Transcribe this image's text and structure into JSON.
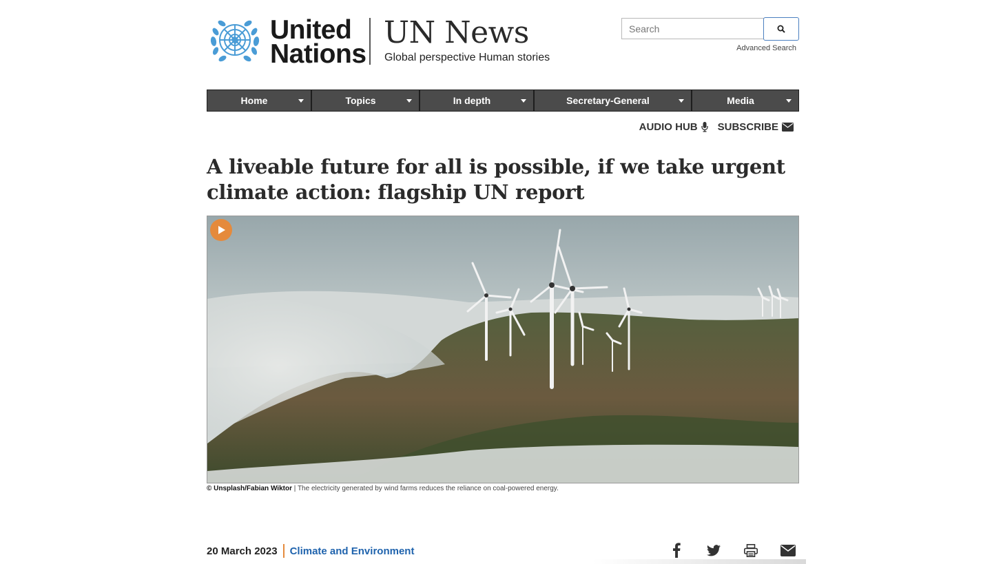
{
  "header": {
    "org_name_line1": "United",
    "org_name_line2": "Nations",
    "site_title": "UN News",
    "tagline": "Global perspective Human stories",
    "search_placeholder": "Search",
    "advanced_search": "Advanced Search",
    "logo_icon": "un-emblem-icon",
    "brand_blue": "#4a9cd6"
  },
  "nav": {
    "items": [
      {
        "label": "Home"
      },
      {
        "label": "Topics"
      },
      {
        "label": "In depth"
      },
      {
        "label": "Secretary-General"
      },
      {
        "label": "Media"
      }
    ],
    "background": "#4b4b4b"
  },
  "utility": {
    "audio_hub": "AUDIO HUB",
    "audio_icon": "microphone-icon",
    "subscribe": "SUBSCRIBE",
    "subscribe_icon": "envelope-icon"
  },
  "article": {
    "headline": "A liveable future for all is possible, if we take urgent climate action: flagship UN report",
    "image_credit": "© Unsplash/Fabian Wiktor",
    "image_caption": " | The electricity generated by wind farms reduces the reliance on coal-powered energy.",
    "date": "20 March 2023",
    "topic": "Climate and Environment",
    "accent": "#e58a3c",
    "link_color": "#1f63ad"
  },
  "share": {
    "icons": [
      "facebook-icon",
      "twitter-icon",
      "print-icon",
      "email-icon"
    ]
  }
}
